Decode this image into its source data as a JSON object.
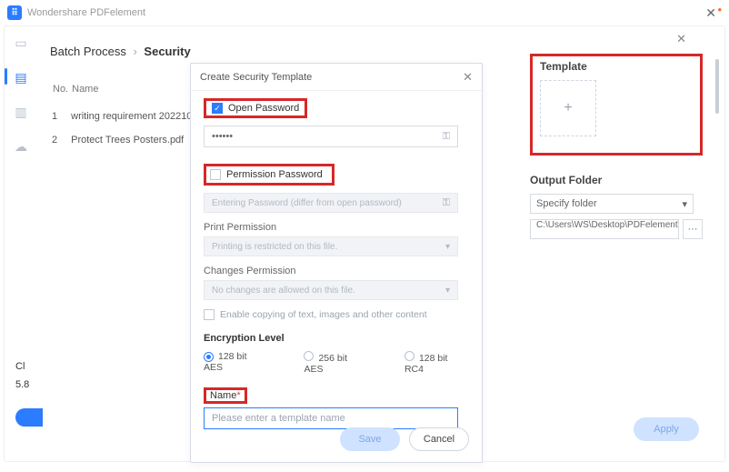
{
  "app_title": "Wondershare PDFelement",
  "breadcrumb": {
    "root": "Batch Process",
    "current": "Security"
  },
  "stats_line1": "Cl",
  "stats_line2": "5.8",
  "table": {
    "headers": {
      "no": "No.",
      "name": "Name"
    },
    "rows": [
      {
        "no": "1",
        "name": "writing requirement 202210"
      },
      {
        "no": "2",
        "name": "Protect Trees Posters.pdf"
      }
    ]
  },
  "dialog": {
    "title": "Create Security Template",
    "open_password": {
      "label": "Open Password",
      "checked": true,
      "masked": "••••••"
    },
    "permission_password": {
      "label": "Permission Password",
      "checked": false,
      "placeholder": "Entering Password (differ from open password)",
      "print_label": "Print Permission",
      "print_value": "Printing is restricted on this file.",
      "changes_label": "Changes Permission",
      "changes_value": "No changes are allowed on this file.",
      "enable_copying": "Enable copying of text, images and other content"
    },
    "encryption": {
      "title": "Encryption Level",
      "options": [
        "128 bit AES",
        "256 bit AES",
        "128 bit RC4"
      ],
      "selected": 0
    },
    "name": {
      "label": "Name",
      "required_mark": "*",
      "placeholder": "Please enter a template name"
    },
    "buttons": {
      "save": "Save",
      "cancel": "Cancel"
    }
  },
  "template_panel": {
    "title": "Template",
    "add_symbol": "+"
  },
  "output_folder": {
    "title": "Output Folder",
    "select_text": "Specify folder",
    "path": "C:\\Users\\WS\\Desktop\\PDFelement\\Sec"
  },
  "apply_label": "Apply"
}
